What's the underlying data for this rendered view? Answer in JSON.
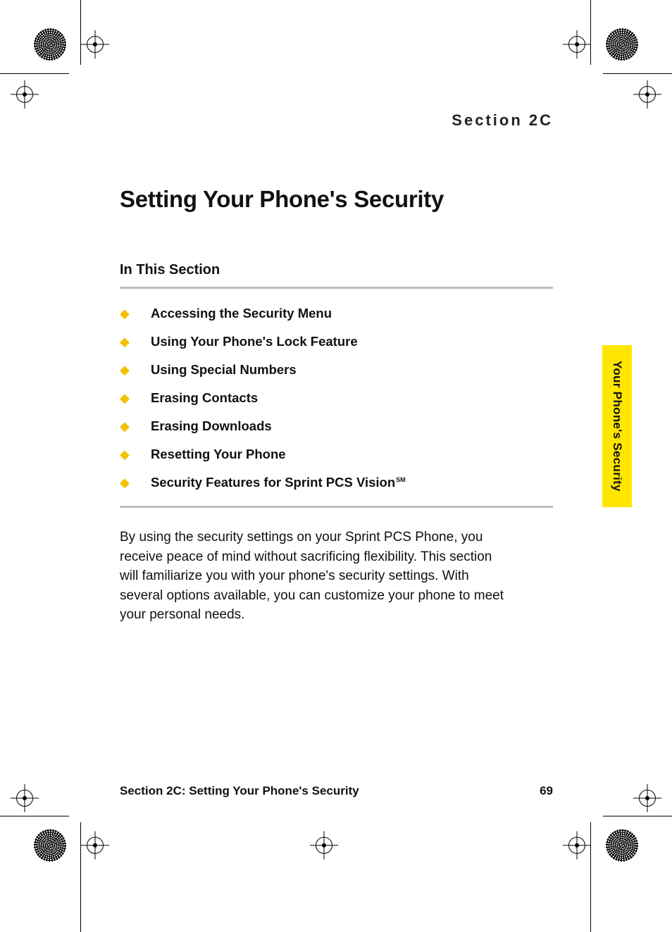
{
  "header": {
    "section_label": "Section 2C"
  },
  "title": "Setting Your Phone's Security",
  "subhead": "In This Section",
  "toc": [
    {
      "label": "Accessing the Security Menu"
    },
    {
      "label": "Using Your Phone's Lock Feature"
    },
    {
      "label": "Using Special Numbers"
    },
    {
      "label": "Erasing Contacts"
    },
    {
      "label": "Erasing Downloads"
    },
    {
      "label": "Resetting Your Phone"
    },
    {
      "label": "Security Features for Sprint PCS Vision",
      "suffix": "SM"
    }
  ],
  "intro": "By using the security settings on your Sprint PCS Phone, you receive peace of mind without sacrificing flexibility. This section will familiarize you with your phone's security settings. With several options available, you can customize your phone to meet your personal needs.",
  "side_tab": "Your Phone's Security",
  "footer": {
    "left": "Section 2C: Setting Your Phone's Security",
    "right": "69"
  },
  "bullet_glyph": "◆"
}
